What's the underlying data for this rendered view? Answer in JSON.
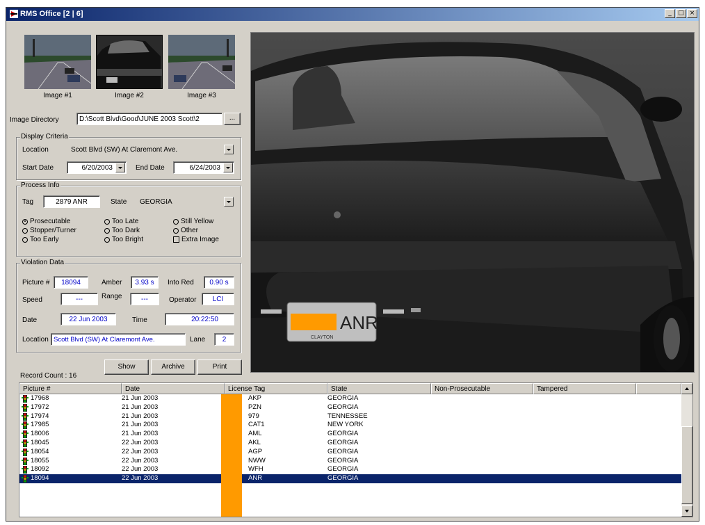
{
  "window": {
    "title": "RMS Office   [2 | 6]",
    "min": "_",
    "max": "□",
    "close": "×"
  },
  "thumbnails": [
    {
      "label": "Image #1"
    },
    {
      "label": "Image #2"
    },
    {
      "label": "Image #3"
    }
  ],
  "image_directory": {
    "label": "Image Directory",
    "value": "D:\\Scott Blvd\\Good\\JUNE 2003 Scott\\2",
    "browse": "..."
  },
  "display_criteria": {
    "title": "Display Criteria",
    "location_label": "Location",
    "location_value": "Scott Blvd (SW) At Claremont Ave.",
    "start_label": "Start Date",
    "start_value": "6/20/2003",
    "end_label": "End Date",
    "end_value": "6/24/2003"
  },
  "process_info": {
    "title": "Process Info",
    "tag_label": "Tag",
    "tag_value": "2879 ANR",
    "state_label": "State",
    "state_value": "GEORGIA",
    "options": {
      "prosecutable": "Prosecutable",
      "too_late": "Too Late",
      "still_yellow": "Still Yellow",
      "stopper_turner": "Stopper/Turner",
      "too_dark": "Too Dark",
      "other": "Other",
      "too_early": "Too Early",
      "too_bright": "Too Bright",
      "extra_image": "Extra Image"
    },
    "selected": "prosecutable"
  },
  "violation_data": {
    "title": "Violation Data",
    "picture_label": "Picture #",
    "picture_value": "18094",
    "amber_label": "Amber",
    "amber_value": "3.93 s",
    "into_red_label": "Into Red",
    "into_red_value": "0.90 s",
    "speed_label": "Speed",
    "speed_value": "---",
    "range_label": "Range",
    "range_value": "---",
    "operator_label": "Operator",
    "operator_value": "LCI",
    "date_label": "Date",
    "date_value": "22 Jun 2003",
    "time_label": "Time",
    "time_value": "20:22:50",
    "location_label": "Location",
    "location_value": "Scott Blvd (SW) At Claremont Ave.",
    "lane_label": "Lane",
    "lane_value": "2"
  },
  "buttons": {
    "show": "Show",
    "archive": "Archive",
    "print": "Print"
  },
  "record_count": "Record Count : 16",
  "viewer": {
    "plate_text": "ANR",
    "plate_sub": "CLAYTON"
  },
  "list": {
    "columns": [
      "Picture #",
      "Date",
      "License Tag",
      "State",
      "Non-Prosecutable",
      "Tampered"
    ],
    "rows": [
      {
        "picture": "17968",
        "date": "21 Jun 2003",
        "tag": "AKP",
        "state": "GEORGIA"
      },
      {
        "picture": "17972",
        "date": "21 Jun 2003",
        "tag": "PZN",
        "state": "GEORGIA"
      },
      {
        "picture": "17974",
        "date": "21 Jun 2003",
        "tag": "979",
        "state": "TENNESSEE"
      },
      {
        "picture": "17985",
        "date": "21 Jun 2003",
        "tag": "CAT1",
        "state": "NEW YORK"
      },
      {
        "picture": "18006",
        "date": "21 Jun 2003",
        "tag": "AML",
        "state": "GEORGIA"
      },
      {
        "picture": "18045",
        "date": "22 Jun 2003",
        "tag": "AKL",
        "state": "GEORGIA"
      },
      {
        "picture": "18054",
        "date": "22 Jun 2003",
        "tag": "AGP",
        "state": "GEORGIA"
      },
      {
        "picture": "18055",
        "date": "22 Jun 2003",
        "tag": "NWW",
        "state": "GEORGIA"
      },
      {
        "picture": "18092",
        "date": "22 Jun 2003",
        "tag": "WFH",
        "state": "GEORGIA"
      },
      {
        "picture": "18094",
        "date": "22 Jun 2003",
        "tag": "ANR",
        "state": "GEORGIA",
        "selected": true
      }
    ]
  },
  "colors": {
    "title_start": "#0a246a",
    "title_end": "#a6caf0",
    "selection": "#0a246a",
    "field_text": "#0000c8",
    "redaction": "#ff9a00"
  }
}
